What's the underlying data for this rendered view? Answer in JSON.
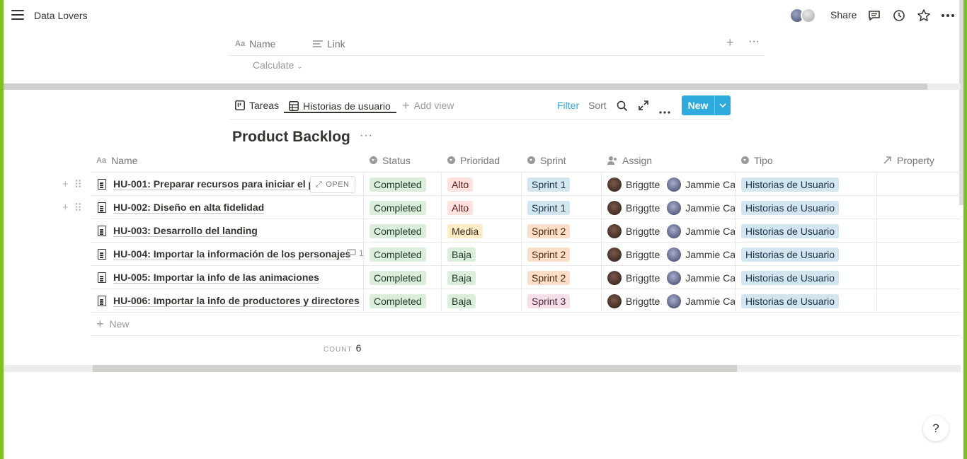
{
  "workspace": {
    "title": "Data Lovers"
  },
  "topbar": {
    "share_label": "Share",
    "icons": [
      "menu-icon",
      "comment-icon",
      "history-icon",
      "star-icon",
      "more-icon"
    ]
  },
  "top_table": {
    "columns": [
      "Name",
      "Link"
    ],
    "calculate_label": "Calculate"
  },
  "views": {
    "tabs": [
      {
        "label": "Tareas",
        "icon": "board-icon",
        "active": false
      },
      {
        "label": "Historias de usuario",
        "icon": "table-icon",
        "active": true
      }
    ],
    "add_view_label": "Add view",
    "filter_label": "Filter",
    "sort_label": "Sort",
    "new_label": "New"
  },
  "database": {
    "title": "Product Backlog",
    "columns": [
      "Name",
      "Status",
      "Prioridad",
      "Sprint",
      "Assign",
      "Tipo",
      "Property"
    ],
    "open_label": "OPEN",
    "rows": [
      {
        "name": "HU-001: Preparar recursos para iniciar el pro",
        "status": "Completed",
        "prioridad": "Alto",
        "sprint": "Sprint 1",
        "assign1": "Briggtte",
        "assign2": "Jammie Ca",
        "tipo": "Historias de Usuario"
      },
      {
        "name": "HU-002: Diseño en alta fidelidad",
        "status": "Completed",
        "prioridad": "Alto",
        "sprint": "Sprint 1",
        "assign1": "Briggtte",
        "assign2": "Jammie Ca",
        "tipo": "Historias de Usuario"
      },
      {
        "name": "HU-003: Desarrollo del landing",
        "status": "Completed",
        "prioridad": "Media",
        "sprint": "Sprint 2",
        "assign1": "Briggtte",
        "assign2": "Jammie Ca",
        "tipo": "Historias de Usuario"
      },
      {
        "name": "HU-004: Importar la información de los personajes",
        "comment_count": "1",
        "status": "Completed",
        "prioridad": "Baja",
        "sprint": "Sprint 2",
        "assign1": "Briggtte",
        "assign2": "Jammie Ca",
        "tipo": "Historias de Usuario"
      },
      {
        "name": "HU-005: Importar la info de las animaciones",
        "status": "Completed",
        "prioridad": "Baja",
        "sprint": "Sprint 2",
        "assign1": "Briggtte",
        "assign2": "Jammie Ca",
        "tipo": "Historias de Usuario"
      },
      {
        "name": "HU-006: Importar la info de productores y directores",
        "status": "Completed",
        "prioridad": "Baja",
        "sprint": "Sprint 3",
        "assign1": "Briggtte",
        "assign2": "Jammie Ca",
        "tipo": "Historias de Usuario"
      }
    ],
    "new_row_label": "New",
    "count_label": "COUNT",
    "count_value": "6"
  },
  "help_label": "?",
  "colors": {
    "accent": "#2eaadc",
    "frame": "#7cc21f"
  }
}
